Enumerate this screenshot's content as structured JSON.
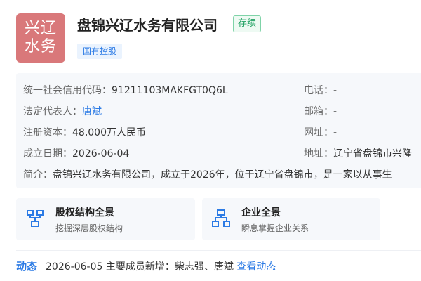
{
  "logo": {
    "line1": "兴辽",
    "line2": "水务"
  },
  "company": {
    "name": "盘锦兴辽水务有限公司",
    "status": "存续",
    "tag": "国有控股"
  },
  "info": {
    "credit_code_label": "统一社会信用代码：",
    "credit_code": "91211103MAKFGT0Q6L",
    "legal_rep_label": "法定代表人：",
    "legal_rep": "唐斌",
    "capital_label": "注册资本：",
    "capital": "48,000万人民币",
    "founded_label": "成立日期：",
    "founded": "2026-06-04",
    "phone_label": "电话：",
    "phone": "-",
    "email_label": "邮箱：",
    "email": "-",
    "website_label": "网址：",
    "website": "-",
    "address_label": "地址：",
    "address": "辽宁省盘锦市兴隆",
    "intro_label": "简介：",
    "intro": "盘锦兴辽水务有限公司，成立于2026年，位于辽宁省盘锦市，是一家以从事生"
  },
  "cards": [
    {
      "title": "股权结构全景",
      "subtitle": "挖掘深层股权结构"
    },
    {
      "title": "企业全景",
      "subtitle": "瞬息掌握企业关系"
    }
  ],
  "dynamic": {
    "tag": "动态",
    "date": "2026-06-05",
    "text": "主要成员新增：柴志强、唐斌",
    "link": "查看动态"
  },
  "colors": {
    "logo_bg": "#d9787a",
    "accent": "#2c7be5",
    "status_green": "#20a162"
  }
}
